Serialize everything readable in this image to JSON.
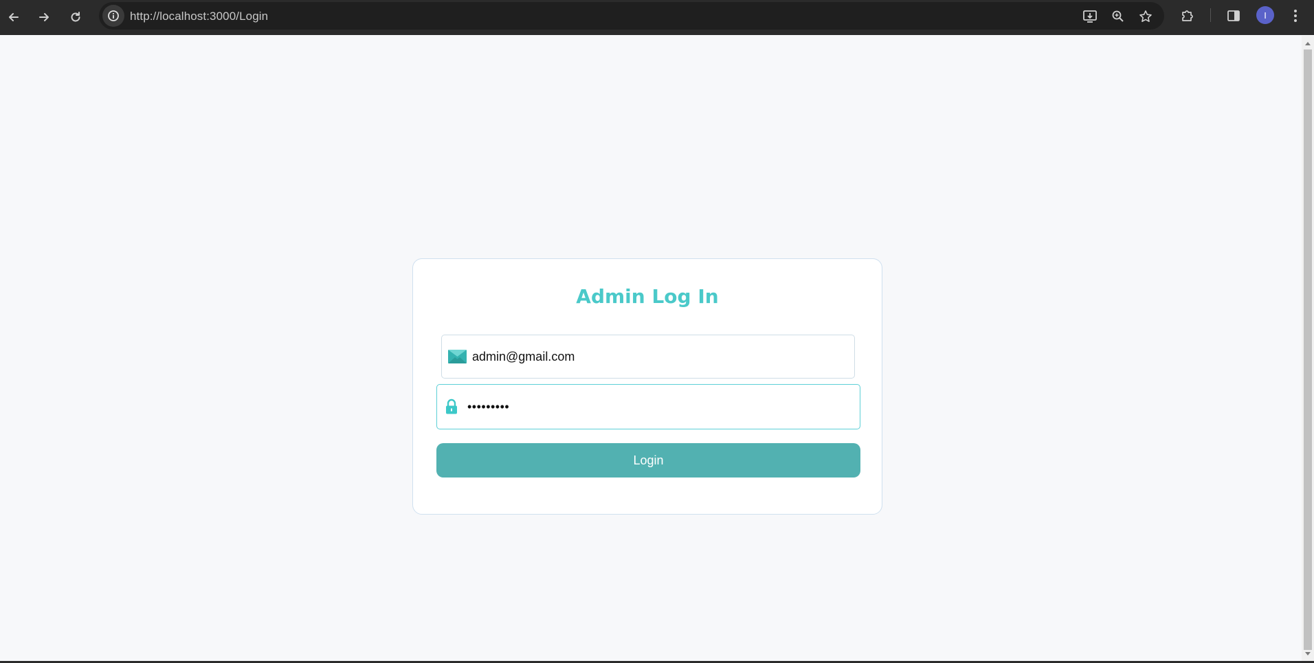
{
  "browser": {
    "url": "http://localhost:3000/Login",
    "profile_initial": "I",
    "icons": {
      "back": "arrow-left-icon",
      "forward": "arrow-right-icon",
      "reload": "reload-icon",
      "site_info": "info-icon",
      "install": "install-app-icon",
      "zoom": "zoom-icon",
      "bookmark": "star-icon",
      "extensions": "puzzle-icon",
      "side_panel": "side-panel-icon",
      "menu": "kebab-menu-icon"
    }
  },
  "login": {
    "title": "Admin Log In",
    "email_value": "admin@gmail.com",
    "email_icon": "envelope-icon",
    "password_value": "•••••••••",
    "password_icon": "lock-icon",
    "button_label": "Login"
  },
  "colors": {
    "accent": "#4ac9c9",
    "button": "#52b1b1",
    "background": "#f7f8fa"
  }
}
